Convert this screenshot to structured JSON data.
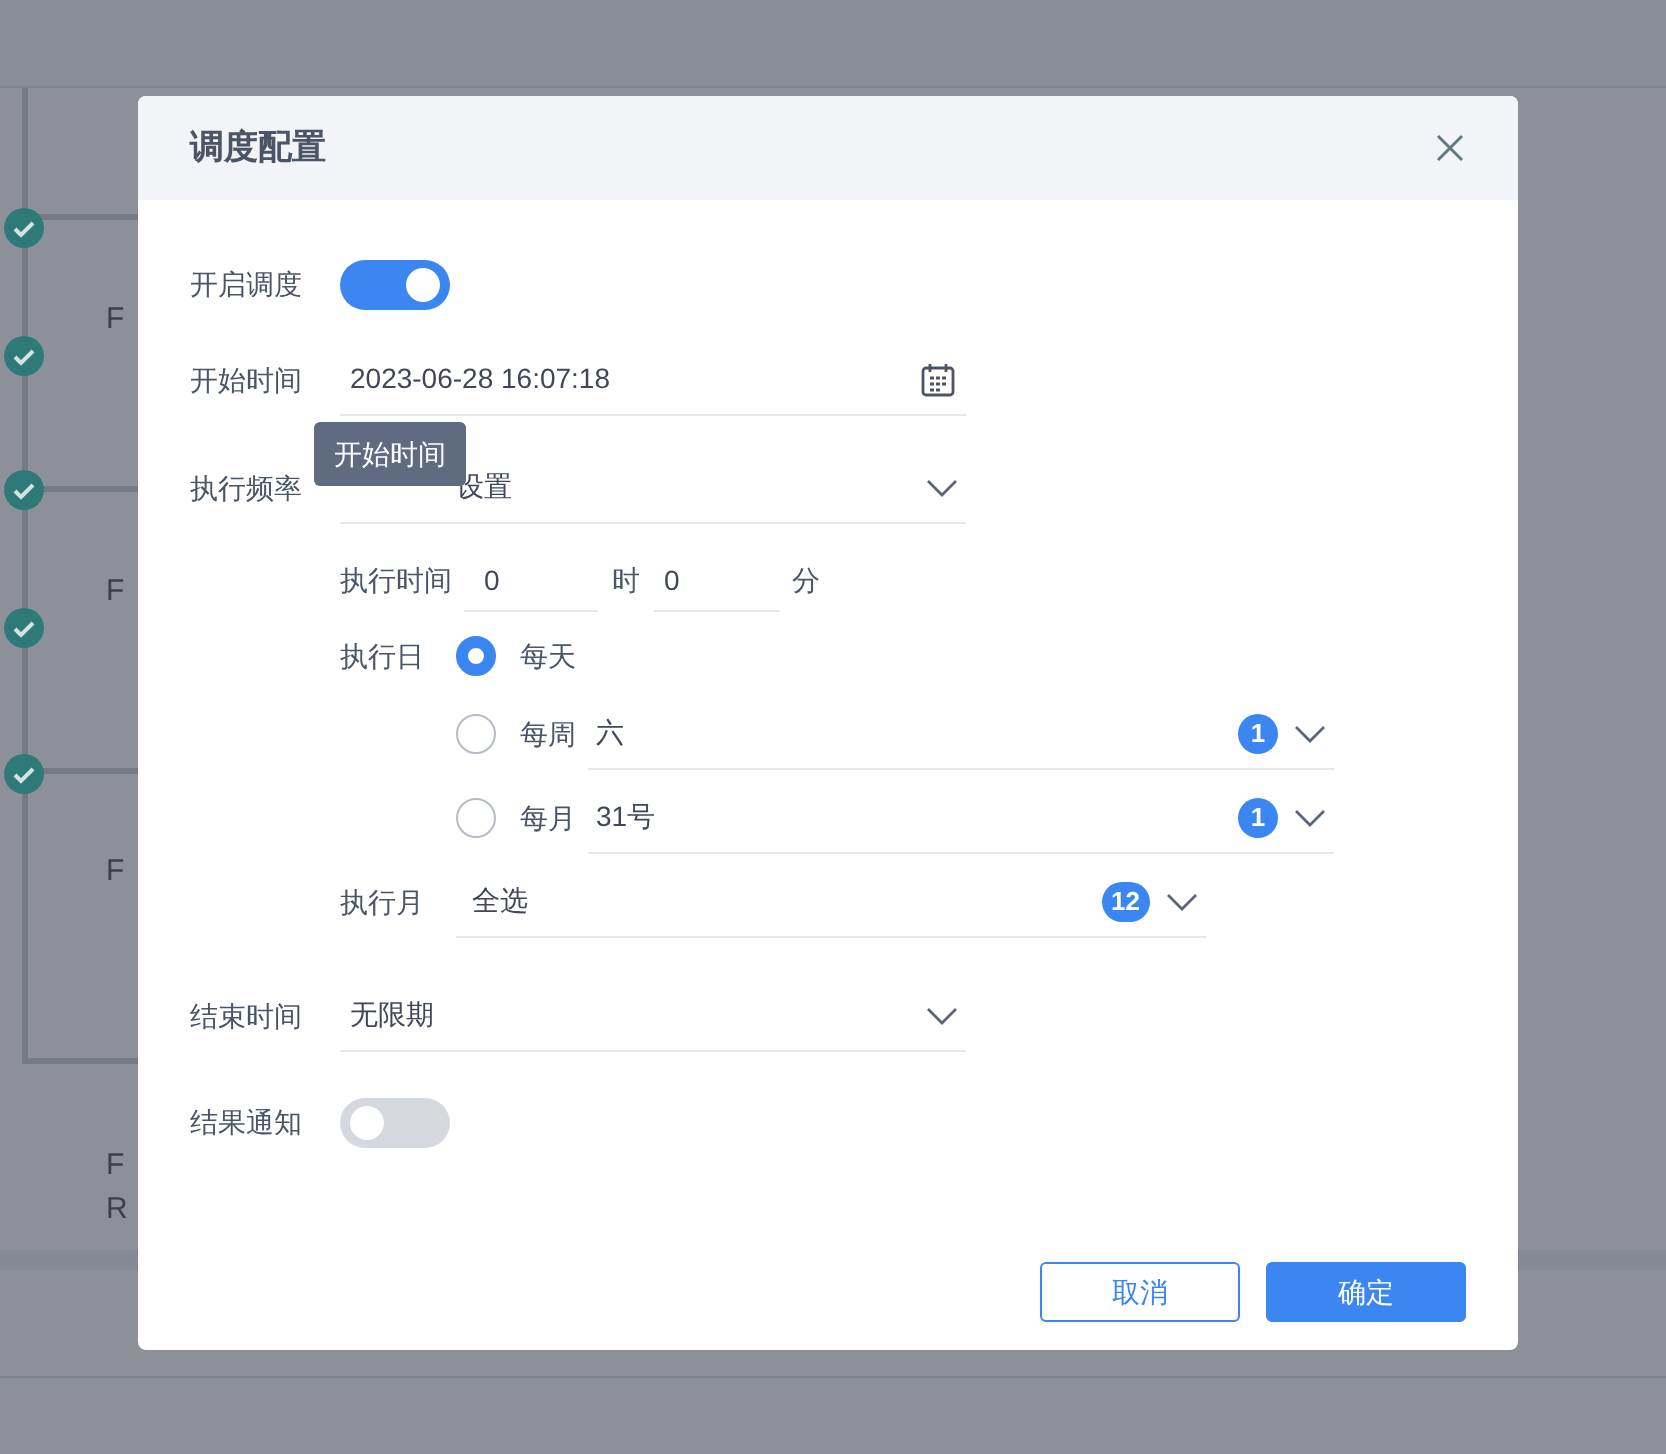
{
  "background": {
    "labels": [
      "F",
      "F",
      "F",
      "F",
      "R"
    ]
  },
  "dialog": {
    "title": "调度配置",
    "schedule_enabled": {
      "label": "开启调度",
      "on": true
    },
    "start_time": {
      "label": "开始时间",
      "value": "2023-06-28 16:07:18"
    },
    "tooltip": "开始时间",
    "frequency": {
      "label": "执行频率",
      "value": "设置"
    },
    "exec_time": {
      "label": "执行时间",
      "hour": "0",
      "hour_unit": "时",
      "minute": "0",
      "minute_unit": "分"
    },
    "exec_day": {
      "label": "执行日",
      "options": [
        {
          "label": "每天",
          "selected": true
        },
        {
          "label": "每周",
          "selected": false,
          "value": "六",
          "count": "1"
        },
        {
          "label": "每月",
          "selected": false,
          "value": "31号",
          "count": "1"
        }
      ]
    },
    "exec_month": {
      "label": "执行月",
      "value": "全选",
      "count": "12"
    },
    "end_time": {
      "label": "结束时间",
      "value": "无限期"
    },
    "notify": {
      "label": "结果通知",
      "on": false
    },
    "buttons": [
      {
        "label": "取消",
        "kind": "secondary"
      },
      {
        "label": "确定",
        "kind": "primary"
      }
    ]
  }
}
